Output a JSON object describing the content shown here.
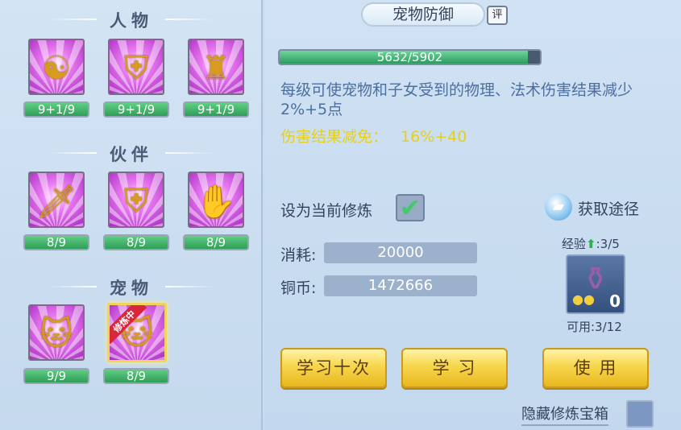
{
  "left": {
    "sections": [
      {
        "title": "人物",
        "skills": [
          {
            "icon": "meditating-figure-icon",
            "level": "9+1/9"
          },
          {
            "icon": "shield-warrior-icon",
            "level": "9+1/9"
          },
          {
            "icon": "armored-warrior-icon",
            "level": "9+1/9"
          }
        ]
      },
      {
        "title": "伙伴",
        "skills": [
          {
            "icon": "sword-beast-icon",
            "level": "8/9"
          },
          {
            "icon": "shield-beast-icon",
            "level": "8/9"
          },
          {
            "icon": "claw-beast-icon",
            "level": "8/9"
          }
        ]
      },
      {
        "title": "宠物",
        "skills": [
          {
            "icon": "sword-cat-icon",
            "level": "9/9"
          },
          {
            "icon": "shield-cat-icon",
            "level": "8/9",
            "tag": "修炼中"
          }
        ]
      }
    ]
  },
  "right": {
    "title": "宠物防御",
    "eval_label": "评",
    "exp": {
      "text": "5632/5902",
      "current": 5632,
      "max": 5902
    },
    "description": "每级可使宠物和子女受到的物理、法术伤害结果减少2%+5点",
    "reduction_label": "伤害结果减免：",
    "reduction_value": "16%+40",
    "set_current_label": "设为当前修炼",
    "set_current_checked": "✔",
    "acquire_label": "获取途径",
    "cost_label": "消耗:",
    "cost_value": "20000",
    "coin_label": "铜币:",
    "coin_value": "1472666",
    "item_exp_label": "经验",
    "item_exp_value": ":3/5",
    "item_count": "0",
    "item_usable": "可用:3/12",
    "btn_learn_ten": "学习十次",
    "btn_learn": "学 习",
    "btn_use": "使 用",
    "hide_label": "隐藏修炼宝箱"
  }
}
